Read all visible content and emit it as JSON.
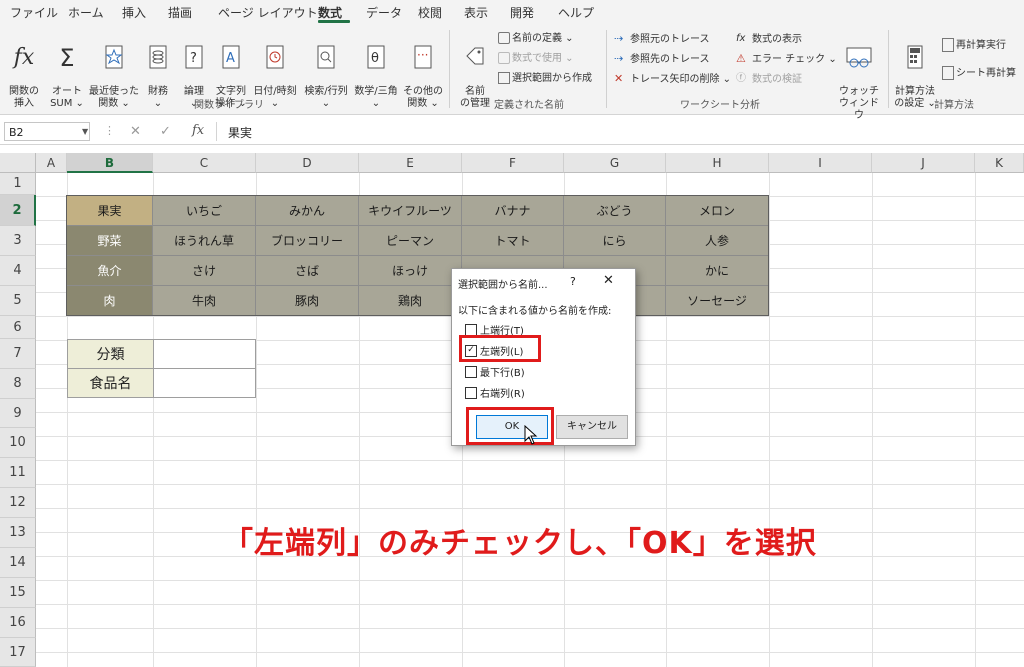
{
  "ribbon_tabs": [
    "ファイル",
    "ホーム",
    "挿入",
    "描画",
    "ページ レイアウト",
    "数式",
    "データ",
    "校閲",
    "表示",
    "開発",
    "ヘルプ"
  ],
  "active_tab": "数式",
  "ribbon": {
    "fx_label": "関数の\n挿入",
    "autosum_label": "オート\nSUM ⌄",
    "recent_label": "最近使った\n関数 ⌄",
    "finance_label": "財務\n⌄",
    "logic_label": "論理\n⌄",
    "text_label": "文字列\n操作 ⌄",
    "date_label": "日付/時刻\n⌄",
    "lookup_label": "検索/行列\n⌄",
    "math_label": "数学/三角\n⌄",
    "other_label": "その他の\n関数 ⌄",
    "group_library": "関数ライブラリ",
    "name_mgr_label": "名前\nの管理",
    "define_name": "名前の定義 ⌄",
    "use_in_formula": "数式で使用 ⌄",
    "create_from_sel": "選択範囲から作成",
    "group_names": "定義された名前",
    "trace_precedents": "参照元のトレース",
    "trace_dependents": "参照先のトレース",
    "remove_arrows": "トレース矢印の削除 ⌄",
    "show_formulas": "数式の表示",
    "error_check": "エラー チェック ⌄",
    "eval_formula": "数式の検証",
    "watch_window": "ウォッチ\nウィンドウ",
    "group_audit": "ワークシート分析",
    "calc_options": "計算方法\nの設定 ⌄",
    "calc_now": "再計算実行",
    "calc_sheet": "シート再計算",
    "group_calc": "計算方法"
  },
  "formula_bar": {
    "name_box": "B2",
    "fx": "fx",
    "value": "果実"
  },
  "columns": [
    "A",
    "B",
    "C",
    "D",
    "E",
    "F",
    "G",
    "H",
    "I",
    "J",
    "K"
  ],
  "rows": [
    "1",
    "2",
    "3",
    "4",
    "5",
    "6",
    "7",
    "8",
    "9",
    "10",
    "11",
    "12",
    "13",
    "14",
    "15",
    "16",
    "17"
  ],
  "table": [
    [
      "果実",
      "いちご",
      "みかん",
      "キウイフルーツ",
      "バナナ",
      "ぶどう",
      "メロン"
    ],
    [
      "野菜",
      "ほうれん草",
      "ブロッコリー",
      "ピーマン",
      "トマト",
      "にら",
      "人参"
    ],
    [
      "魚介",
      "さけ",
      "さば",
      "ほっけ",
      "",
      "",
      "かに"
    ],
    [
      "肉",
      "牛肉",
      "豚肉",
      "鶏肉",
      "",
      "",
      "ソーセージ"
    ]
  ],
  "lookup_labels": [
    "分類",
    "食品名"
  ],
  "dialog": {
    "title": "選択範囲から名前...",
    "help": "?",
    "close": "✕",
    "prompt": "以下に含まれる値から名前を作成:",
    "options": [
      {
        "label": "上端行(T)",
        "checked": false
      },
      {
        "label": "左端列(L)",
        "checked": true
      },
      {
        "label": "最下行(B)",
        "checked": false
      },
      {
        "label": "右端列(R)",
        "checked": false
      }
    ],
    "ok": "OK",
    "cancel": "キャンセル"
  },
  "caption": "「左端列」のみチェックし、「OK」を選択",
  "colors": {
    "highlight": "#e01b1b",
    "excel_green": "#217346",
    "table_header": "#8b8870",
    "table_body": "#a8a697",
    "selected_cell": "#c2b083"
  }
}
